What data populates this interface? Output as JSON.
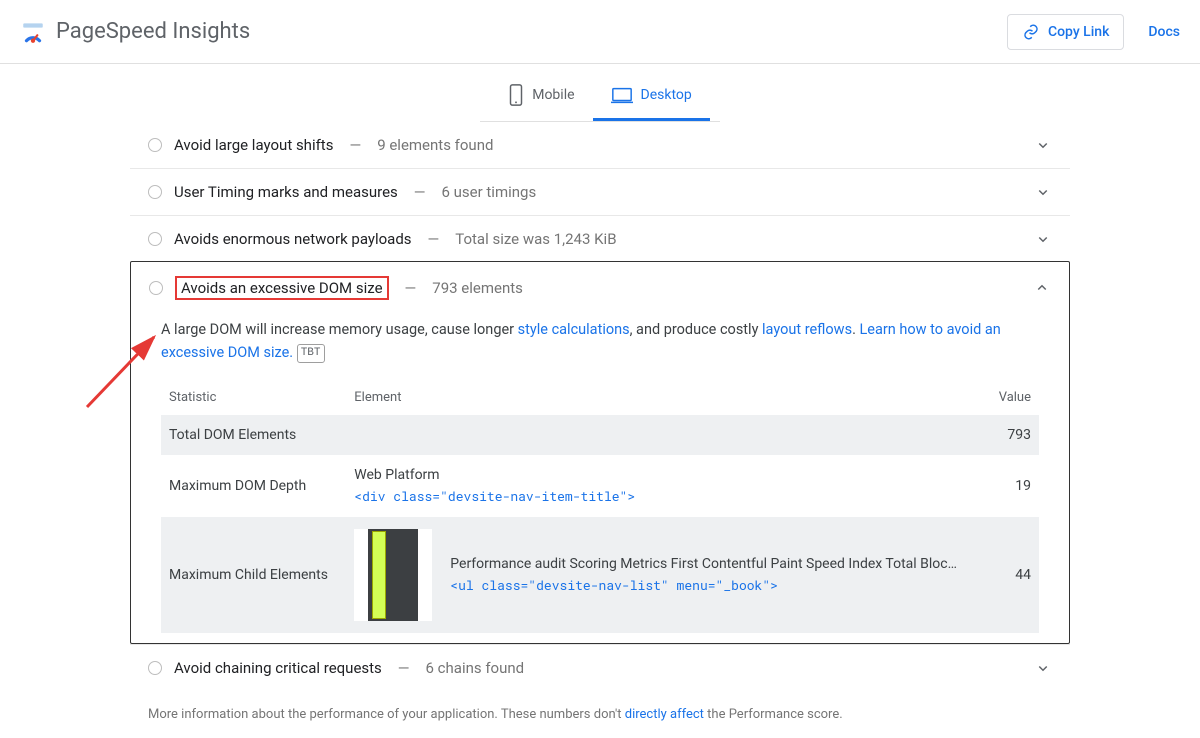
{
  "header": {
    "title": "PageSpeed Insights",
    "copy_link": "Copy Link",
    "docs": "Docs"
  },
  "tabs": {
    "mobile": "Mobile",
    "desktop": "Desktop"
  },
  "audits": {
    "large_shifts": {
      "title": "Avoid large layout shifts",
      "sub": "9 elements found"
    },
    "user_timing": {
      "title": "User Timing marks and measures",
      "sub": "6 user timings"
    },
    "payloads": {
      "title": "Avoids enormous network payloads",
      "sub": "Total size was 1,243 KiB"
    },
    "dom_size": {
      "title": "Avoids an excessive DOM size",
      "sub": "793 elements"
    },
    "chain": {
      "title": "Avoid chaining critical requests",
      "sub": "6 chains found"
    }
  },
  "dom_detail": {
    "desc_1": "A large DOM will increase memory usage, cause longer ",
    "link_style": "style calculations",
    "desc_2": ", and produce costly ",
    "link_reflow": "layout reflows",
    "link_learn": "Learn how to avoid an excessive DOM size.",
    "badge": "TBT",
    "table": {
      "headers": {
        "stat": "Statistic",
        "element": "Element",
        "value": "Value"
      },
      "rows": {
        "total": {
          "stat": "Total DOM Elements",
          "element_name": "",
          "element_code": "",
          "value": "793"
        },
        "depth": {
          "stat": "Maximum DOM Depth",
          "element_name": "Web Platform",
          "element_code": "<div class=\"devsite-nav-item-title\">",
          "value": "19"
        },
        "children": {
          "stat": "Maximum Child Elements",
          "element_name": "Performance audit Scoring Metrics First Contentful Paint Speed Index Total Bloc…",
          "element_code": "<ul class=\"devsite-nav-list\" menu=\"_book\">",
          "value": "44"
        }
      }
    }
  },
  "footnote": {
    "pre": "More information about the performance of your application. These numbers don't ",
    "link": "directly affect",
    "post": " the Performance score."
  }
}
